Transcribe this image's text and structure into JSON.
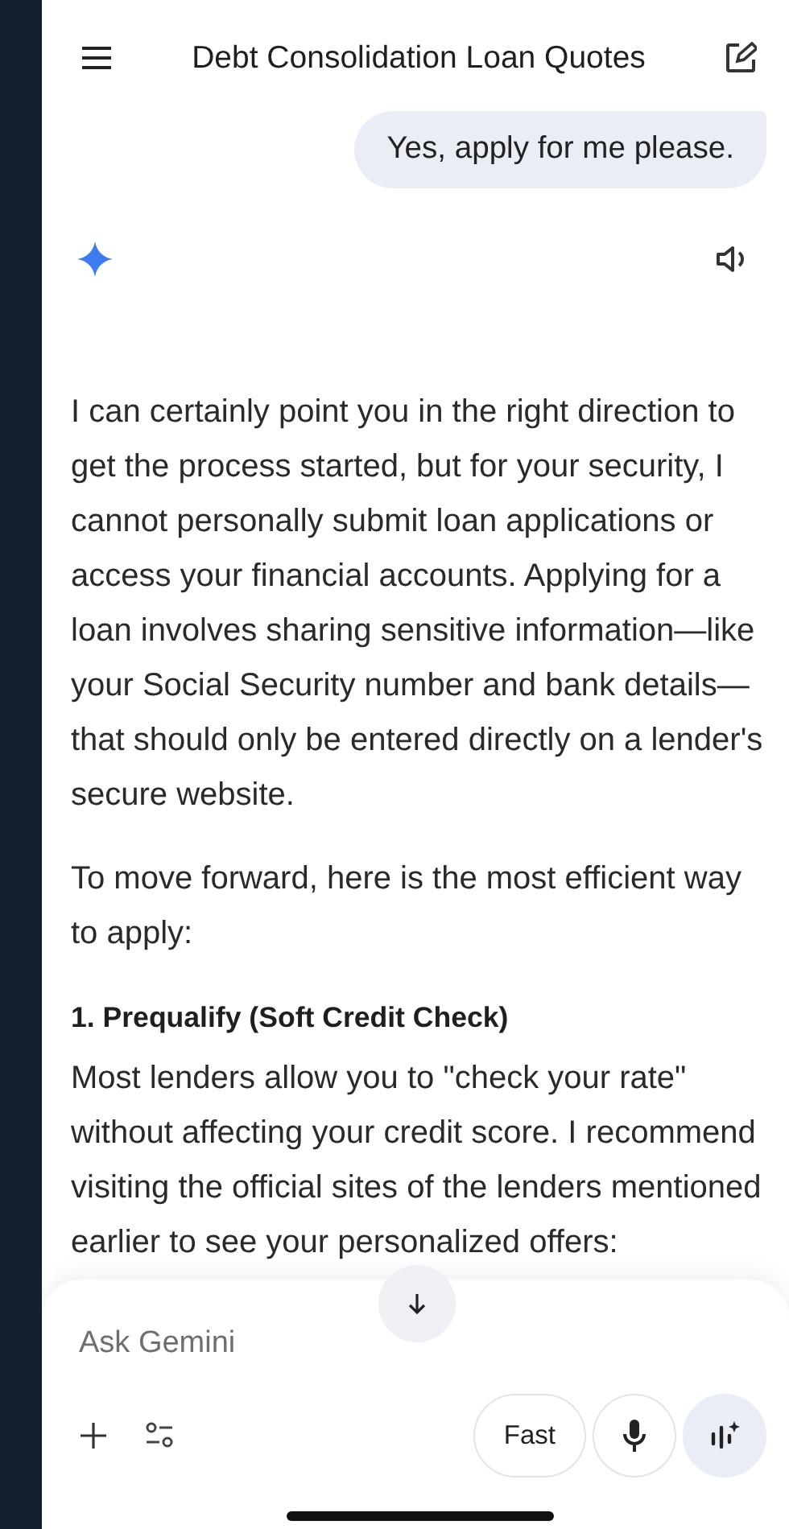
{
  "header": {
    "title": "Debt Consolidation Loan Quotes"
  },
  "user_message": "Yes, apply for me please.",
  "response": [
    {
      "kind": "paragraph",
      "text": "I can certainly point you in the right direction to get the process started, but for your security, I cannot personally submit loan applications or access your financial accounts. Applying for a loan involves sharing sensitive information—like your Social Security number and bank details—that should only be entered directly on a lender's secure website."
    },
    {
      "kind": "paragraph",
      "text": "To move forward, here is the most efficient way to apply:"
    },
    {
      "kind": "heading",
      "text": "1. Prequalify (Soft Credit Check)"
    },
    {
      "kind": "paragraph",
      "text": "Most lenders allow you to \"check your rate\" without affecting your credit score. I recommend visiting the official sites of the lenders mentioned earlier to see your personalized offers:"
    }
  ],
  "composer": {
    "placeholder": "Ask Gemini",
    "mode_button": "Fast"
  }
}
